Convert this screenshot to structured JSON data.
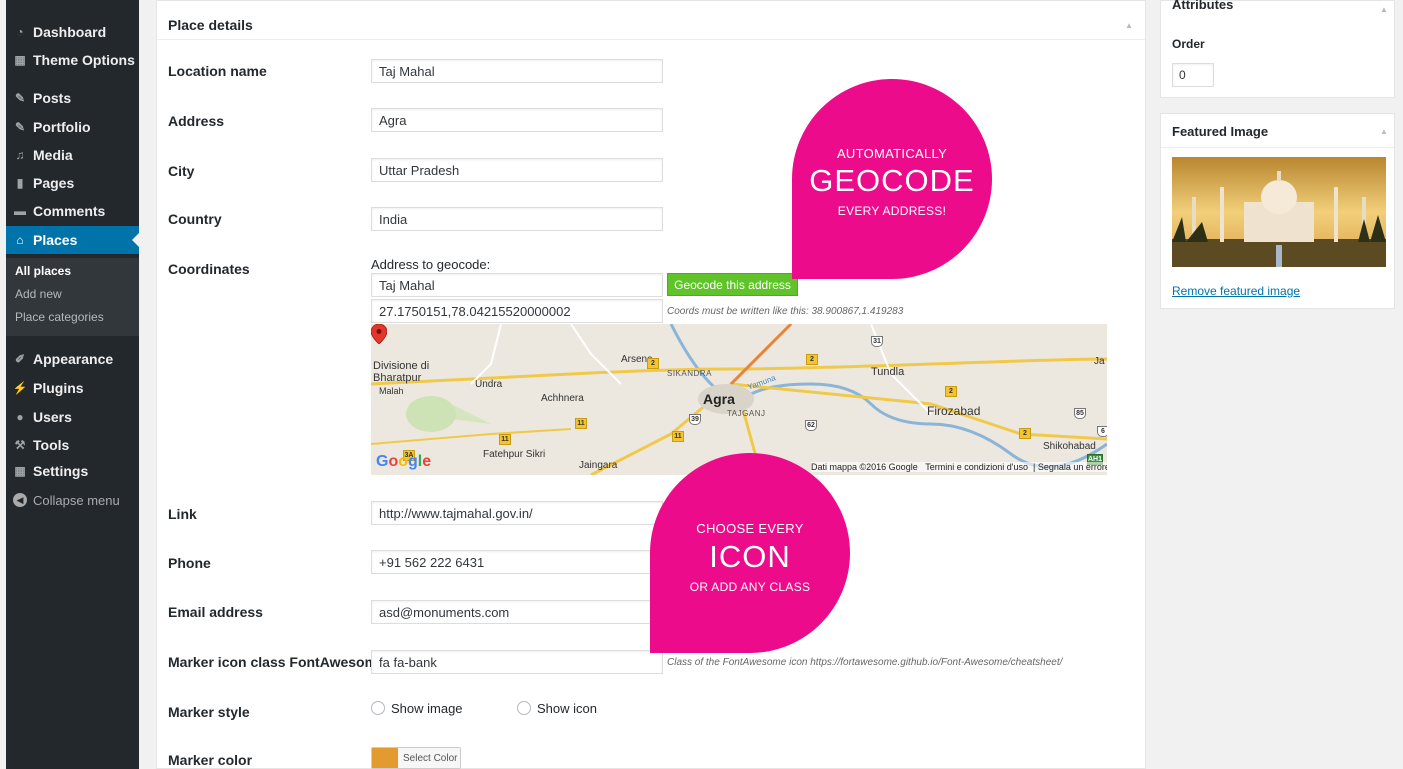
{
  "sidebar": {
    "items": [
      {
        "label": "Dashboard",
        "icon": "dashboard-icon"
      },
      {
        "label": "Theme Options",
        "icon": "theme-options-icon"
      },
      {
        "label": "Posts",
        "icon": "pushpin-icon"
      },
      {
        "label": "Portfolio",
        "icon": "pushpin-icon"
      },
      {
        "label": "Media",
        "icon": "media-icon"
      },
      {
        "label": "Pages",
        "icon": "pages-icon"
      },
      {
        "label": "Comments",
        "icon": "comment-icon"
      },
      {
        "label": "Places",
        "icon": "places-icon"
      },
      {
        "label": "Appearance",
        "icon": "brush-icon"
      },
      {
        "label": "Plugins",
        "icon": "plug-icon"
      },
      {
        "label": "Users",
        "icon": "user-icon"
      },
      {
        "label": "Tools",
        "icon": "wrench-icon"
      },
      {
        "label": "Settings",
        "icon": "settings-icon"
      }
    ],
    "submenu": [
      "All places",
      "Add new",
      "Place categories"
    ],
    "collapse_label": "Collapse menu"
  },
  "place_details": {
    "title": "Place details",
    "location_name": {
      "label": "Location name",
      "value": "Taj Mahal"
    },
    "address": {
      "label": "Address",
      "value": "Agra"
    },
    "city": {
      "label": "City",
      "value": "Uttar Pradesh"
    },
    "country": {
      "label": "Country",
      "value": "India"
    },
    "coordinates": {
      "label": "Coordinates",
      "geocode_label": "Address to geocode:",
      "geocode_value": "Taj Mahal",
      "geocode_button": "Geocode this address",
      "coords_value": "27.1750151,78.04215520000002",
      "coords_hint": "Coords must be written like this: 38.900867,1.419283"
    },
    "link": {
      "label": "Link",
      "value": "http://www.tajmahal.gov.in/"
    },
    "phone": {
      "label": "Phone",
      "value": "+91 562 222 6431"
    },
    "email": {
      "label": "Email address",
      "value": "asd@monuments.com"
    },
    "marker_icon": {
      "label": "Marker icon class FontAwesome",
      "value": "fa fa-bank",
      "hint": "Class of the FontAwesome icon https://fortawesome.github.io/Font-Awesome/cheatsheet/"
    },
    "marker_style": {
      "label": "Marker style",
      "options": [
        "Show image",
        "Show icon"
      ]
    },
    "marker_color": {
      "label": "Marker color",
      "button": "Select Color",
      "value": "#e39a2f"
    }
  },
  "map": {
    "places": [
      "Divisione di",
      "Bharatpur",
      "Malah",
      "Undra",
      "Achhnera",
      "Arsena",
      "SIKANDRA",
      "Agra",
      "TAJGANJ",
      "Tundla",
      "Firozabad",
      "Fatehpur Sikri",
      "Jaingara",
      "Shikohabad",
      "Yamuna",
      "Ja"
    ],
    "road_shields": [
      "2",
      "2",
      "2",
      "2",
      "11",
      "11",
      "11",
      "31",
      "39",
      "62",
      "85",
      "3A",
      "AH1",
      "6"
    ],
    "attribution": "Dati mappa ©2016 Google",
    "terms": "Termini e condizioni d'uso",
    "report": "Segnala un errore nella mappa",
    "logo": "Google"
  },
  "callouts": [
    {
      "line1": "AUTOMATICALLY",
      "line2": "GEOCODE",
      "line3": "EVERY ADDRESS!"
    },
    {
      "line1": "CHOOSE EVERY",
      "line2": "ICON",
      "line3": "OR ADD ANY CLASS"
    }
  ],
  "attributes": {
    "title": "Attributes",
    "order_label": "Order",
    "order_value": "0"
  },
  "featured_image": {
    "title": "Featured Image",
    "remove_link": "Remove featured image"
  },
  "colors": {
    "accent": "#0073aa",
    "callout": "#ec0b8a",
    "geocode_button": "#61c32a",
    "sidebar": "#23282d"
  }
}
